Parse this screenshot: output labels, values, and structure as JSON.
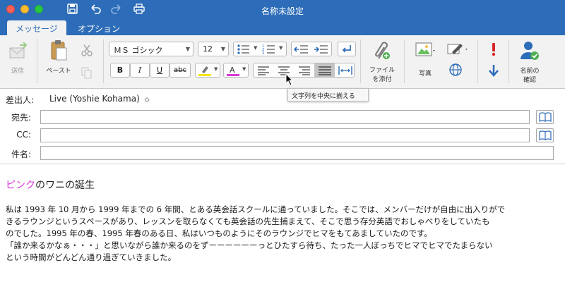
{
  "window": {
    "title": "名称未設定"
  },
  "tabs": [
    {
      "label": "メッセージ",
      "active": true
    },
    {
      "label": "オプション",
      "active": false
    }
  ],
  "ribbon": {
    "send_label": "送信",
    "paste_label": "ペースト",
    "font_name": "ＭＳ ゴシック",
    "font_size": "12",
    "attach_label_1": "ファイル",
    "attach_label_2": "を添付",
    "picture_label": "写真",
    "check_names_label_1": "名前の",
    "check_names_label_2": "確認",
    "bold": "B",
    "italic": "I",
    "underline": "U",
    "strike": "abc",
    "highlight_color": "#f5e400",
    "font_color": "#d83bd8"
  },
  "tooltip": {
    "text": "文字列を中央に揃える"
  },
  "header": {
    "from_label": "差出人:",
    "from_value": "Live (Yoshie Kohama)",
    "to_label": "宛先:",
    "cc_label": "CC:",
    "subject_label": "件名:"
  },
  "body": {
    "title_pink": "ピンク",
    "title_rest": "のワニの誕生",
    "lines": [
      "私は 1993 年 10 月から 1999 年までの 6 年間、とある英会話スクールに通っていました。そこでは、メンバーだけが自由に出入りがで",
      "きるラウンジというスペースがあり、レッスンを取らなくても英会話の先生捕まえて、そこで思う存分英語でおしゃべりをしていたも",
      "のでした。1995 年の春、1995 年春のある日、私はいつものようにそのラウンジでヒマをもてあましていたのです。",
      "「誰か来るかなぁ・・・」と思いながら誰か来るのをずーーーーーーっとひたすら待ち、たった一人ぼっちでヒマでヒマでたまらない",
      "という時間がどんどん通り過ぎていきました。"
    ]
  },
  "colors": {
    "accent": "#2d6cb8",
    "ribbon_bg": "#f2f2f2"
  }
}
